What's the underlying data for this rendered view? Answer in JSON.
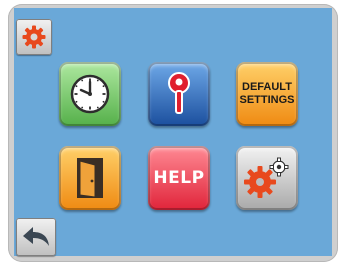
{
  "top_left_button": {
    "icon": "gear-icon"
  },
  "bottom_left_button": {
    "icon": "back-arrow-icon"
  },
  "tiles": [
    {
      "name": "clock",
      "icon": "clock-icon"
    },
    {
      "name": "key",
      "icon": "key-icon"
    },
    {
      "name": "default-settings",
      "line1": "DEFAULT",
      "line2": "SETTINGS"
    },
    {
      "name": "exit",
      "icon": "door-icon"
    },
    {
      "name": "help",
      "label": "HELP"
    },
    {
      "name": "settings",
      "icon": "gears-icon"
    }
  ],
  "colors": {
    "screen": "#6aa8d8",
    "gear": "#e8491d"
  }
}
